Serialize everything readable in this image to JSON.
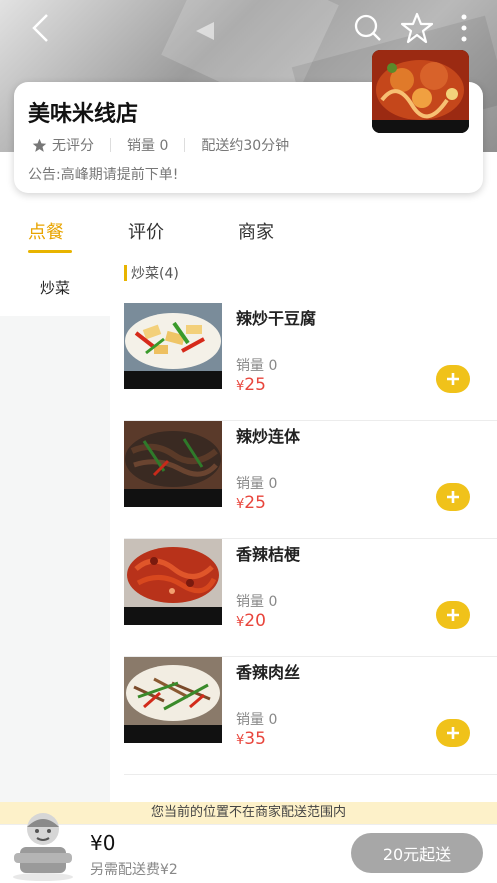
{
  "store": {
    "name": "美味米线店",
    "rating_text": "无评分",
    "sales_text": "销量 0",
    "delivery_time": "配送约30分钟",
    "notice": "公告:高峰期请提前下单!"
  },
  "tabs": [
    {
      "label": "点餐",
      "active": true
    },
    {
      "label": "评价",
      "active": false
    },
    {
      "label": "商家",
      "active": false
    }
  ],
  "sidebar": {
    "items": [
      {
        "label": "炒菜",
        "selected": true
      }
    ]
  },
  "category": {
    "title": "炒菜(4)"
  },
  "products": [
    {
      "name": "辣炒干豆腐",
      "sales": "销量 0",
      "currency": "¥",
      "price": "25"
    },
    {
      "name": "辣炒连体",
      "sales": "销量 0",
      "currency": "¥",
      "price": "25"
    },
    {
      "name": "香辣桔梗",
      "sales": "销量 0",
      "currency": "¥",
      "price": "20"
    },
    {
      "name": "香辣肉丝",
      "sales": "销量 0",
      "currency": "¥",
      "price": "35"
    }
  ],
  "delivery_notice": "您当前的位置不在商家配送范围内",
  "cart": {
    "total": "¥0",
    "delivery_fee": "另需配送费¥2",
    "checkout_label": "20元起送"
  },
  "colors": {
    "accent": "#e8b400",
    "price": "#e8453c",
    "add_button": "#f0c21a",
    "checkout_disabled": "#a7a7a7",
    "notice_bg": "#fdf1c9"
  },
  "icons": [
    "back-icon",
    "search-icon",
    "star-outline-icon",
    "more-vertical-icon",
    "star-filled-icon",
    "plus-icon",
    "cart-mascot-icon"
  ]
}
